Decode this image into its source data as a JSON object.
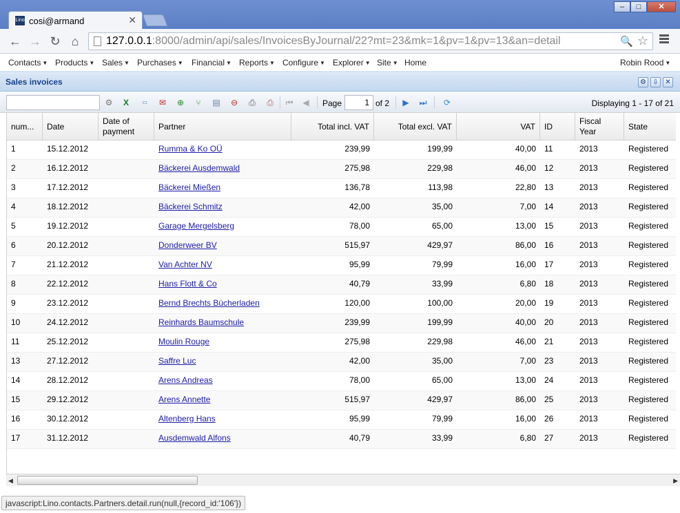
{
  "browser": {
    "tab_title": "cosi@armand",
    "favicon_text": "Lino",
    "url_host": "127.0.0.1",
    "url_rest": ":8000/admin/api/sales/InvoicesByJournal/22?mt=23&mk=1&pv=1&pv=13&an=detail",
    "window_min": "‒",
    "window_max": "□",
    "window_close": "✕",
    "tab_close": "✕"
  },
  "app_menu": {
    "items": [
      "Contacts",
      "Products",
      "Sales",
      "Purchases",
      "Financial",
      "Reports",
      "Configure",
      "Explorer",
      "Site",
      "Home"
    ],
    "user": "Robin Rood"
  },
  "panel": {
    "title": "Sales invoices"
  },
  "grid_toolbar": {
    "quick_filter_value": "",
    "page_label": "Page",
    "page_value": "1",
    "page_of": "of 2",
    "displaying": "Displaying 1 - 17 of 21"
  },
  "grid": {
    "columns": [
      "num...",
      "Date",
      "Date of payment",
      "Partner",
      "Total incl. VAT",
      "Total excl. VAT",
      "VAT",
      "ID",
      "Fiscal Year",
      "State"
    ],
    "rows": [
      [
        "1",
        "15.12.2012",
        "",
        "Rumma & Ko OÜ",
        "239,99",
        "199,99",
        "40,00",
        "11",
        "2013",
        "Registered"
      ],
      [
        "2",
        "16.12.2012",
        "",
        "Bäckerei Ausdemwald",
        "275,98",
        "229,98",
        "46,00",
        "12",
        "2013",
        "Registered"
      ],
      [
        "3",
        "17.12.2012",
        "",
        "Bäckerei Mießen",
        "136,78",
        "113,98",
        "22,80",
        "13",
        "2013",
        "Registered"
      ],
      [
        "4",
        "18.12.2012",
        "",
        "Bäckerei Schmitz",
        "42,00",
        "35,00",
        "7,00",
        "14",
        "2013",
        "Registered"
      ],
      [
        "5",
        "19.12.2012",
        "",
        "Garage Mergelsberg",
        "78,00",
        "65,00",
        "13,00",
        "15",
        "2013",
        "Registered"
      ],
      [
        "6",
        "20.12.2012",
        "",
        "Donderweer BV",
        "515,97",
        "429,97",
        "86,00",
        "16",
        "2013",
        "Registered"
      ],
      [
        "7",
        "21.12.2012",
        "",
        "Van Achter NV",
        "95,99",
        "79,99",
        "16,00",
        "17",
        "2013",
        "Registered"
      ],
      [
        "8",
        "22.12.2012",
        "",
        "Hans Flott & Co",
        "40,79",
        "33,99",
        "6,80",
        "18",
        "2013",
        "Registered"
      ],
      [
        "9",
        "23.12.2012",
        "",
        "Bernd Brechts Bücherladen",
        "120,00",
        "100,00",
        "20,00",
        "19",
        "2013",
        "Registered"
      ],
      [
        "10",
        "24.12.2012",
        "",
        "Reinhards Baumschule",
        "239,99",
        "199,99",
        "40,00",
        "20",
        "2013",
        "Registered"
      ],
      [
        "11",
        "25.12.2012",
        "",
        "Moulin Rouge",
        "275,98",
        "229,98",
        "46,00",
        "21",
        "2013",
        "Registered"
      ],
      [
        "13",
        "27.12.2012",
        "",
        "Saffre Luc",
        "42,00",
        "35,00",
        "7,00",
        "23",
        "2013",
        "Registered"
      ],
      [
        "14",
        "28.12.2012",
        "",
        "Arens Andreas",
        "78,00",
        "65,00",
        "13,00",
        "24",
        "2013",
        "Registered"
      ],
      [
        "15",
        "29.12.2012",
        "",
        "Arens Annette",
        "515,97",
        "429,97",
        "86,00",
        "25",
        "2013",
        "Registered"
      ],
      [
        "16",
        "30.12.2012",
        "",
        "Altenberg Hans",
        "95,99",
        "79,99",
        "16,00",
        "26",
        "2013",
        "Registered"
      ],
      [
        "17",
        "31.12.2012",
        "",
        "Ausdemwald Alfons",
        "40,79",
        "33,99",
        "6,80",
        "27",
        "2013",
        "Registered"
      ]
    ]
  },
  "status_bar": {
    "text": "javascript:Lino.contacts.Partners.detail.run(null,{record_id:'106'})"
  },
  "colors": {
    "link": "#1c1ca8",
    "panel_title": "#15428b",
    "header_bg": "#c5d8ef"
  }
}
